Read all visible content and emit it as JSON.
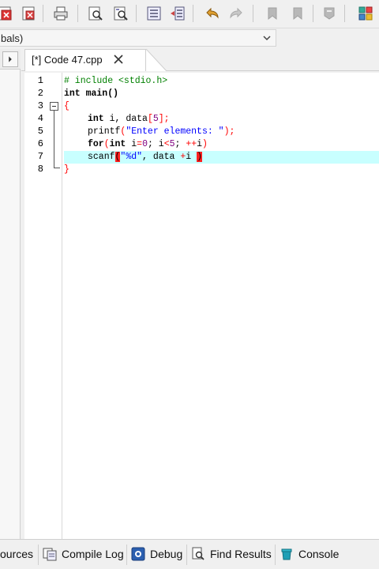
{
  "toolbar": {
    "icons": [
      "close-all-icon",
      "close-file-icon",
      "print-icon",
      "find-icon",
      "replace-icon",
      "indent-icon",
      "unindent-icon",
      "undo-icon",
      "redo-icon",
      "bookmark-toggle-icon",
      "bookmark-goto-icon",
      "compile-icon",
      "grid-icon"
    ]
  },
  "scope": {
    "value": "bals)"
  },
  "editor": {
    "tab_label": "[*] Code 47.cpp",
    "lines": [
      {
        "n": "1"
      },
      {
        "n": "2"
      },
      {
        "n": "3"
      },
      {
        "n": "4"
      },
      {
        "n": "5"
      },
      {
        "n": "6"
      },
      {
        "n": "7"
      },
      {
        "n": "8"
      }
    ],
    "code": {
      "l1": "# include <stdio.h>",
      "l2": "int main()",
      "l3": "{",
      "l4a": "int",
      "l4b": " i, data",
      "l4c": "[",
      "l4d": "5",
      "l4e": "];",
      "l5a": "printf",
      "l5b": "(",
      "l5c": "\"Enter elements: \"",
      "l5d": ");",
      "l6a": "for",
      "l6b": "(",
      "l6c": "int",
      "l6d": " i",
      "l6e": "=",
      "l6f": "0",
      "l6g": "; i",
      "l6h": "<",
      "l6i": "5",
      "l6j": "; ",
      "l6k": "++",
      "l6l": "i",
      "l6m": ")",
      "l7a": "scanf",
      "l7b": "(",
      "l7c": "\"%d\"",
      "l7d": ", data ",
      "l7e": "+",
      "l7f": "i ",
      "l7g": ")",
      "l8": "}"
    }
  },
  "bottom_tabs": {
    "resources": "ources",
    "compile_log": "Compile Log",
    "debug": "Debug",
    "find_results": "Find Results",
    "console": "Console"
  },
  "colors": {
    "current_line": "#c8ffff",
    "keyword": "#000000",
    "preprocessor": "#008000",
    "string": "#0000ff",
    "number": "#800080",
    "symbol": "#ff0000",
    "bracket_match": "#ff2020"
  }
}
